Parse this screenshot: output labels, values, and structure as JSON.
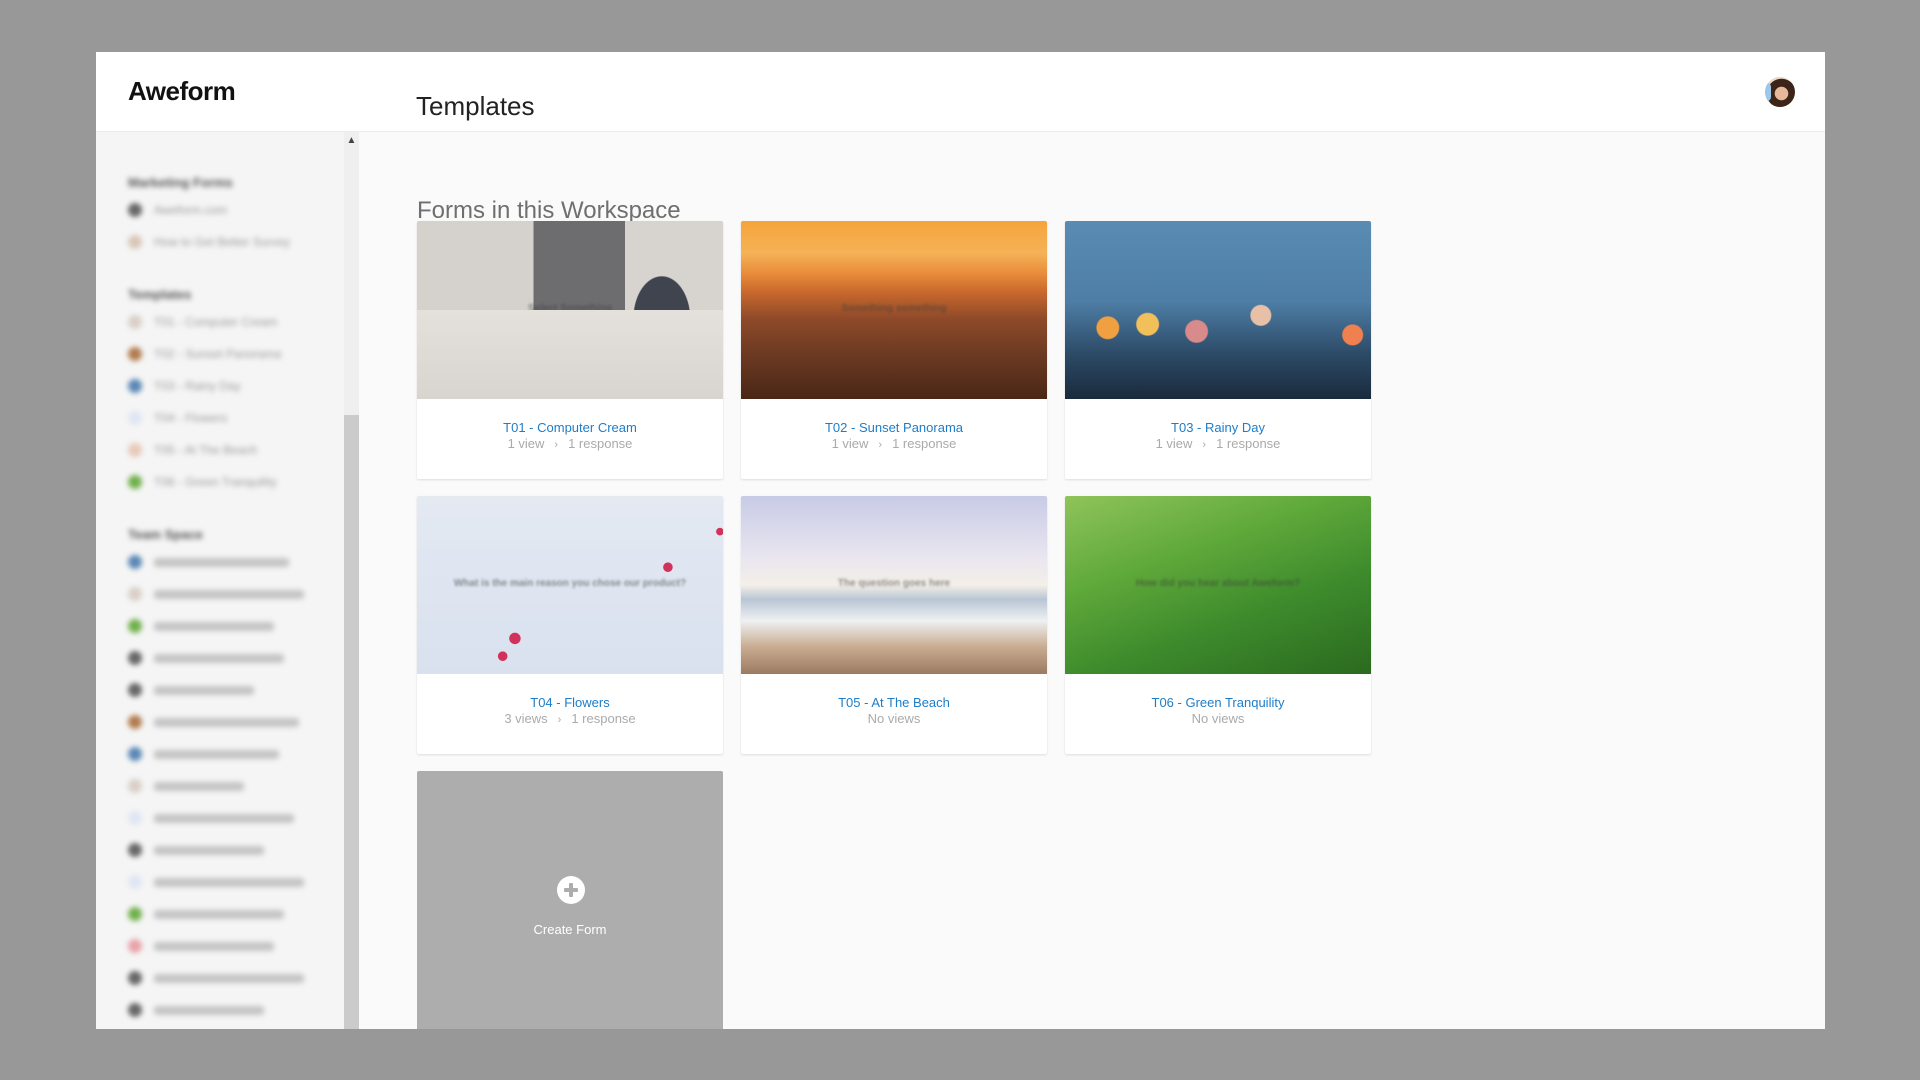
{
  "app": {
    "name": "Aweform"
  },
  "header": {
    "title": "Templates",
    "avatar_icon": "user-avatar"
  },
  "sidebar": {
    "blurred": true,
    "sections": [
      {
        "heading": "Marketing Forms",
        "items": [
          {
            "label": "Aweform.com",
            "color": "#666666"
          },
          {
            "label": "How to Get Better Survey",
            "color": "#d9c7b8"
          }
        ]
      },
      {
        "heading": "Templates",
        "items": [
          {
            "label": "T01 - Computer Cream",
            "color": "#d9cfc6"
          },
          {
            "label": "T02 - Sunset Panorama",
            "color": "#b07b4e"
          },
          {
            "label": "T03 - Rainy Day",
            "color": "#5a87b5"
          },
          {
            "label": "T04 - Flowers",
            "color": "#dfe6f2"
          },
          {
            "label": "T05 - At The Beach",
            "color": "#e8c9b8"
          },
          {
            "label": "T06 - Green Tranquility",
            "color": "#6fb04a"
          }
        ]
      },
      {
        "heading": "Team Space",
        "items": [
          {
            "label": "",
            "color": "#5a87b5"
          },
          {
            "label": "",
            "color": "#d9cfc6"
          },
          {
            "label": "",
            "color": "#6fb04a"
          },
          {
            "label": "",
            "color": "#666666"
          },
          {
            "label": "",
            "color": "#666666"
          },
          {
            "label": "",
            "color": "#b07b4e"
          },
          {
            "label": "",
            "color": "#5a87b5"
          },
          {
            "label": "",
            "color": "#d9cfc6"
          },
          {
            "label": "",
            "color": "#dfe6f2"
          },
          {
            "label": "",
            "color": "#666666"
          },
          {
            "label": "",
            "color": "#dfe6f2"
          },
          {
            "label": "",
            "color": "#6fb04a"
          },
          {
            "label": "",
            "color": "#e8a2a8"
          },
          {
            "label": "",
            "color": "#666666"
          },
          {
            "label": "",
            "color": "#666666"
          }
        ]
      }
    ]
  },
  "main": {
    "section_title": "Forms in this Workspace",
    "cards": [
      {
        "title": "T01 - Computer Cream",
        "views": "1 view",
        "responses": "1 response",
        "image_class": "img-t01",
        "overlay": "Select Something"
      },
      {
        "title": "T02 - Sunset Panorama",
        "views": "1 view",
        "responses": "1 response",
        "image_class": "img-t02",
        "overlay": "Something something"
      },
      {
        "title": "T03 - Rainy Day",
        "views": "1 view",
        "responses": "1 response",
        "image_class": "img-t03",
        "overlay": ""
      },
      {
        "title": "T04 - Flowers",
        "views": "3 views",
        "responses": "1 response",
        "image_class": "img-t04",
        "overlay": "What is the main reason you chose our product?"
      },
      {
        "title": "T05 - At The Beach",
        "views": "No views",
        "responses": "",
        "image_class": "img-t05",
        "overlay": "The question goes here"
      },
      {
        "title": "T06 - Green Tranquility",
        "views": "No views",
        "responses": "",
        "image_class": "img-t06",
        "overlay": "How did you hear about Aweform?"
      }
    ],
    "create": {
      "label": "Create Form",
      "icon": "plus-circle-icon"
    },
    "stats_separator": "›"
  },
  "colors": {
    "link": "#1e7dc8",
    "muted": "#aaaaaa",
    "create_card": "#adadad"
  }
}
